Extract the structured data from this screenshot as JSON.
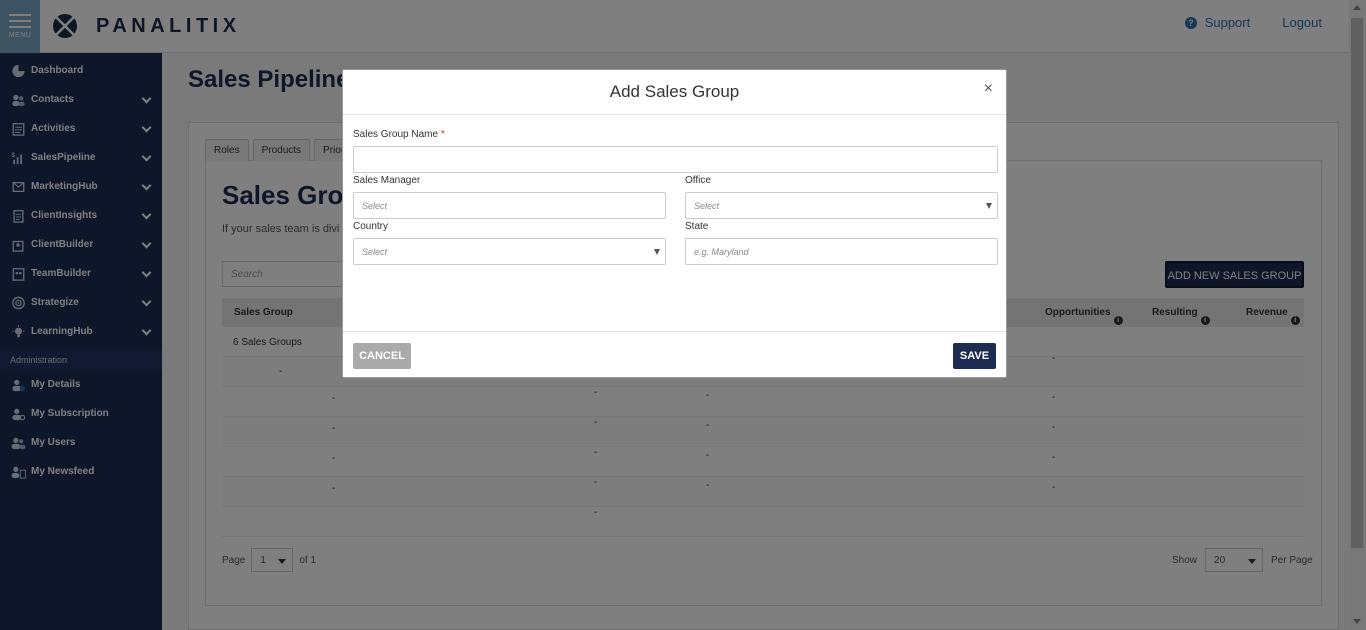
{
  "header": {
    "menu_label": "MENU",
    "logo_text": "PANALITIX",
    "support_label": "Support",
    "logout_label": "Logout"
  },
  "sidebar": {
    "items": [
      {
        "label": "Dashboard",
        "icon": "pie-chart-icon",
        "has_chevron": false
      },
      {
        "label": "Contacts",
        "icon": "contacts-icon",
        "has_chevron": true
      },
      {
        "label": "Activities",
        "icon": "activities-icon",
        "has_chevron": true
      },
      {
        "label": "SalesPipeline",
        "icon": "sales-pipeline-icon",
        "has_chevron": true
      },
      {
        "label": "MarketingHub",
        "icon": "marketing-icon",
        "has_chevron": true
      },
      {
        "label": "ClientInsights",
        "icon": "clipboard-icon",
        "has_chevron": true
      },
      {
        "label": "ClientBuilder",
        "icon": "client-builder-icon",
        "has_chevron": true
      },
      {
        "label": "TeamBuilder",
        "icon": "team-builder-icon",
        "has_chevron": true
      },
      {
        "label": "Strategize",
        "icon": "target-icon",
        "has_chevron": true
      },
      {
        "label": "LearningHub",
        "icon": "lightbulb-icon",
        "has_chevron": true
      }
    ],
    "admin_header": "Administration",
    "admin_items": [
      {
        "label": "My Details",
        "icon": "user-info-icon"
      },
      {
        "label": "My Subscription",
        "icon": "user-key-icon"
      },
      {
        "label": "My Users",
        "icon": "users-icon"
      },
      {
        "label": "My Newsfeed",
        "icon": "newsfeed-icon"
      }
    ]
  },
  "page": {
    "title": "Sales Pipeline",
    "tabs": [
      "Roles",
      "Products",
      "Priorit"
    ],
    "section_title": "Sales Grou",
    "section_desc": "If your sales team is divi",
    "search_placeholder": "Search",
    "add_button": "ADD NEW SALES GROUP",
    "table": {
      "headers": [
        "Sales Group",
        "Opportunities",
        "Resulting",
        "Revenue"
      ],
      "first_row": "6 Sales Groups",
      "dash": "-"
    },
    "pager": {
      "page_label": "Page",
      "page_value": "1",
      "of_label": "of 1",
      "show_label": "Show",
      "show_value": "20",
      "per_page_label": "Per Page"
    }
  },
  "modal": {
    "title": "Add Sales Group",
    "close": "×",
    "name_label": "Sales Group Name",
    "required_mark": "*",
    "name_value": "",
    "manager_label": "Sales Manager",
    "manager_placeholder": "Select",
    "office_label": "Office",
    "office_placeholder": "Select",
    "country_label": "Country",
    "country_placeholder": "Select",
    "state_label": "State",
    "state_placeholder": "e.g. Maryland",
    "cancel_label": "CANCEL",
    "save_label": "SAVE"
  },
  "colors": {
    "brand_navy": "#1c2c52",
    "link_blue": "#2a6fa8",
    "menu_blue": "#7fa9c7"
  }
}
